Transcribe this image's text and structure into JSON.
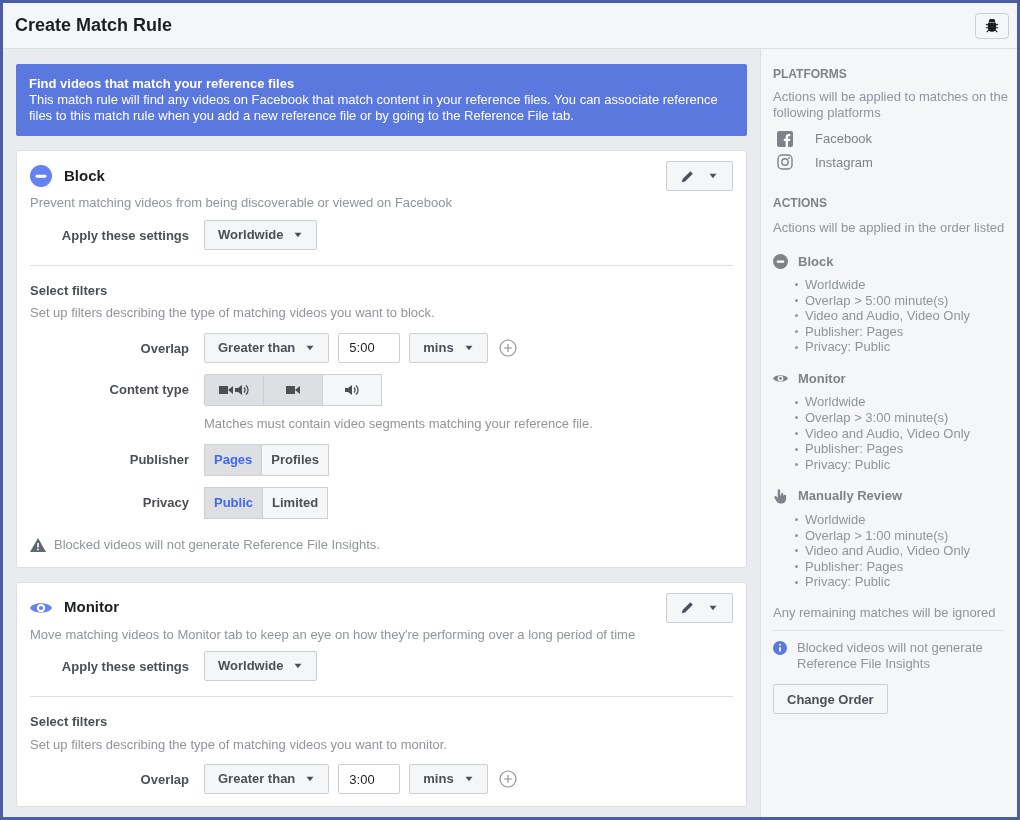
{
  "window": {
    "title": "Create Match Rule"
  },
  "banner": {
    "title": "Find videos that match your reference files",
    "text": "This match rule will find any videos on Facebook that match content in your reference files. You can associate reference files to this match rule when you add a new reference file or by going to the Reference File tab."
  },
  "actions": [
    {
      "kind": "block",
      "title": "Block",
      "description": "Prevent matching videos from being discoverable or viewed on Facebook",
      "apply_label": "Apply these settings",
      "apply_value": "Worldwide",
      "filters_title": "Select filters",
      "filters_description": "Set up filters describing the type of matching videos you want to block.",
      "filters": [
        {
          "kind": "overlap",
          "label": "Overlap",
          "comparison": "Greater than",
          "value": "5:00",
          "unit": "mins"
        },
        {
          "kind": "content_type",
          "label": "Content type",
          "options": [
            {
              "kind": "video_audio",
              "selected": true
            },
            {
              "kind": "video",
              "selected": true
            },
            {
              "kind": "audio",
              "selected": false
            }
          ],
          "hint": "Matches must contain video segments matching your reference file."
        },
        {
          "kind": "segmented",
          "label": "Publisher",
          "options": [
            {
              "label": "Pages",
              "selected": true
            },
            {
              "label": "Profiles",
              "selected": false
            }
          ]
        },
        {
          "kind": "segmented",
          "label": "Privacy",
          "options": [
            {
              "label": "Public",
              "selected": true
            },
            {
              "label": "Limited",
              "selected": false
            }
          ]
        }
      ],
      "warning": "Blocked videos will not generate Reference File Insights."
    },
    {
      "kind": "monitor",
      "title": "Monitor",
      "description": "Move matching videos to Monitor tab to keep an eye on how they're performing over a long period of time",
      "apply_label": "Apply these settings",
      "apply_value": "Worldwide",
      "filters_title": "Select filters",
      "filters_description": "Set up filters describing the type of matching videos you want to monitor.",
      "filters": [
        {
          "kind": "overlap",
          "label": "Overlap",
          "comparison": "Greater than",
          "value": "3:00",
          "unit": "mins"
        }
      ]
    }
  ],
  "sidebar": {
    "platforms": {
      "title": "PLATFORMS",
      "description": "Actions will be applied to matches on the following platforms",
      "items": [
        {
          "kind": "facebook",
          "label": "Facebook"
        },
        {
          "kind": "instagram",
          "label": "Instagram"
        }
      ]
    },
    "actions": {
      "title": "ACTIONS",
      "description": "Actions will be applied in the order listed",
      "items": [
        {
          "kind": "block",
          "title": "Block",
          "details": [
            "Worldwide",
            "Overlap > 5:00 minute(s)",
            "Video and Audio, Video Only",
            "Publisher: Pages",
            "Privacy: Public"
          ]
        },
        {
          "kind": "monitor",
          "title": "Monitor",
          "details": [
            "Worldwide",
            "Overlap > 3:00 minute(s)",
            "Video and Audio, Video Only",
            "Publisher: Pages",
            "Privacy: Public"
          ]
        },
        {
          "kind": "review",
          "title": "Manually Review",
          "details": [
            "Worldwide",
            "Overlap > 1:00 minute(s)",
            "Video and Audio, Video Only",
            "Publisher: Pages",
            "Privacy: Public"
          ]
        }
      ]
    },
    "note": "Any remaining matches will be ignored",
    "info": "Blocked videos will not generate Reference File Insights",
    "button": "Change Order"
  }
}
